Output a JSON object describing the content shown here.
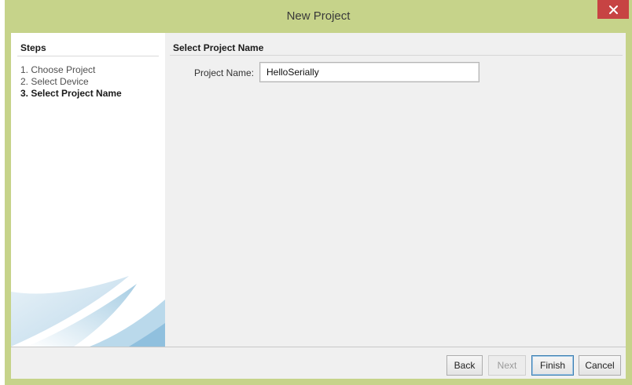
{
  "window": {
    "title": "New Project"
  },
  "steps": {
    "heading": "Steps",
    "items": [
      {
        "label": "1. Choose Project",
        "current": false
      },
      {
        "label": "2. Select Device",
        "current": false
      },
      {
        "label": "3. Select Project Name",
        "current": true
      }
    ]
  },
  "content": {
    "heading": "Select Project Name",
    "project_name_label": "Project Name:",
    "project_name_value": "HelloSerially"
  },
  "buttons": {
    "back": "Back",
    "next": "Next",
    "finish": "Finish",
    "cancel": "Cancel"
  },
  "colors": {
    "frame": "#c6d38a",
    "close": "#c74343"
  }
}
